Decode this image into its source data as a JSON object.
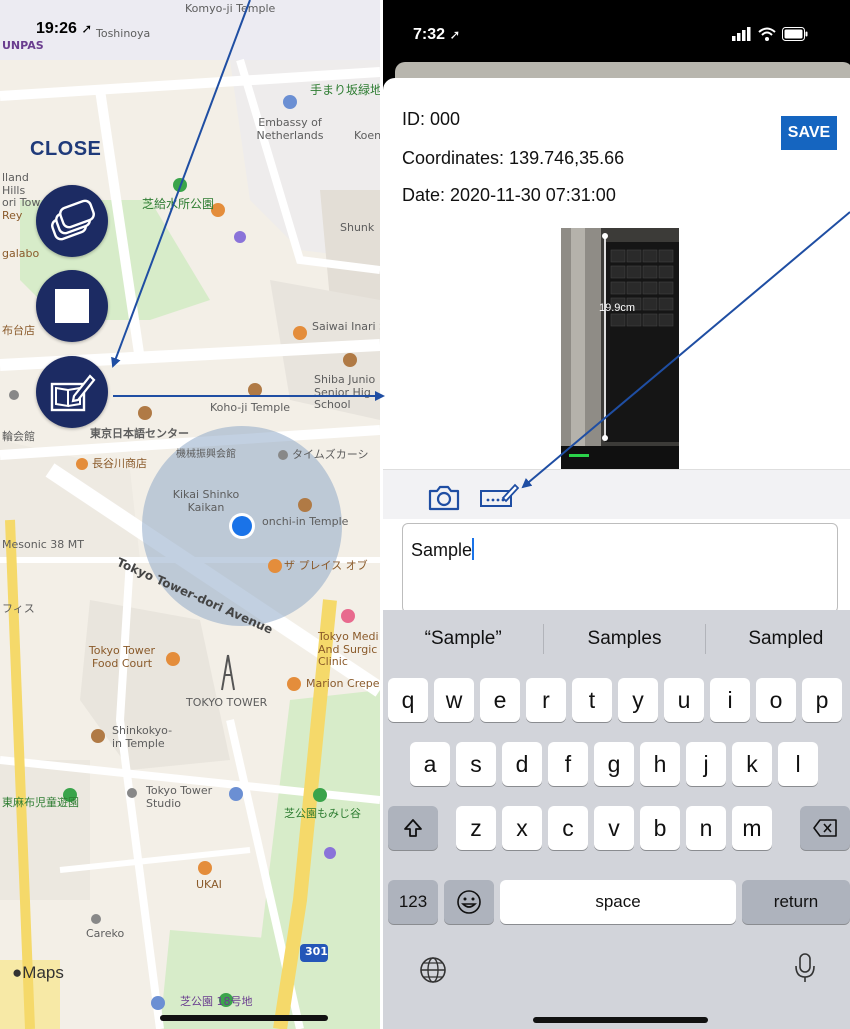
{
  "map_screen": {
    "status_time": "19:26",
    "close_label": "CLOSE",
    "buttons": [
      {
        "name": "layers-button",
        "icon": "layers-icon"
      },
      {
        "name": "stop-button",
        "icon": "stop-icon"
      },
      {
        "name": "memo-button",
        "icon": "memo-edit-icon"
      }
    ],
    "labels": [
      {
        "t": "Komyo-ji Temple"
      },
      {
        "t": "UNPAS"
      },
      {
        "t": "Toshinoya"
      },
      {
        "t": "手まり坂緑地"
      },
      {
        "t": "Embassy of Netherlands"
      },
      {
        "t": "Koen"
      },
      {
        "t": "lland Hills ori Tow"
      },
      {
        "t": "Rey"
      },
      {
        "t": "galabo"
      },
      {
        "t": "芝給水所公園"
      },
      {
        "t": "Shunk"
      },
      {
        "t": "Saiwai Inari Shrine"
      },
      {
        "t": "Shiba Junio Senior Hig School"
      },
      {
        "t": "布台店"
      },
      {
        "t": "Koho-ji Temple"
      },
      {
        "t": "輪会館"
      },
      {
        "t": "東京日本語センター"
      },
      {
        "t": "長谷川商店"
      },
      {
        "t": "機械振興会館"
      },
      {
        "t": "タイムズカーシ"
      },
      {
        "t": "Kikai Shinko Kaikan"
      },
      {
        "t": "onchi-in Temple"
      },
      {
        "t": "Mesonic 38 MT"
      },
      {
        "t": "ザ プレイス オブ"
      },
      {
        "t": "フィス"
      },
      {
        "t": "Tokyo Tower Food Court"
      },
      {
        "t": "Tokyo Medi And Surgic Clinic"
      },
      {
        "t": "Marion Crepe"
      },
      {
        "t": "TOKYO TOWER"
      },
      {
        "t": "Shinkokyo- in Temple"
      },
      {
        "t": "東麻布児童遊園"
      },
      {
        "t": "Tokyo Tower Studio"
      },
      {
        "t": "芝公園もみじ谷"
      },
      {
        "t": "UKAI"
      },
      {
        "t": "Careko"
      },
      {
        "t": "芝公園 18号地"
      }
    ],
    "road_label": "Tokyo Tower-dori Avenue",
    "route_shield": "301",
    "maps_brand": "Maps"
  },
  "detail_screen": {
    "status_time": "7:32",
    "id_line": "ID: 000",
    "coordinates_line": "Coordinates: 139.746,35.66",
    "date_line": "Date: 2020-11-30 07:31:00",
    "save_label": "SAVE",
    "photo_measure": "19.9cm",
    "toolbar": [
      "camera-icon",
      "keyboard-pen-icon"
    ],
    "note_text": "Sample",
    "suggestions": [
      "“Sample”",
      "Samples",
      "Sampled"
    ],
    "keyboard": {
      "row1": [
        "q",
        "w",
        "e",
        "r",
        "t",
        "y",
        "u",
        "i",
        "o",
        "p"
      ],
      "row2": [
        "a",
        "s",
        "d",
        "f",
        "g",
        "h",
        "j",
        "k",
        "l"
      ],
      "row3": [
        "z",
        "x",
        "c",
        "v",
        "b",
        "n",
        "m"
      ],
      "numbers_key": "123",
      "space_key": "space",
      "return_key": "return"
    }
  },
  "colors": {
    "fab": "#1c2b63",
    "close_text": "#1f3a7a",
    "save_bg": "#1565c0",
    "arrow": "#1f4ea3",
    "location_dot": "#1a73e8",
    "keyboard_bg": "#d2d4da"
  }
}
